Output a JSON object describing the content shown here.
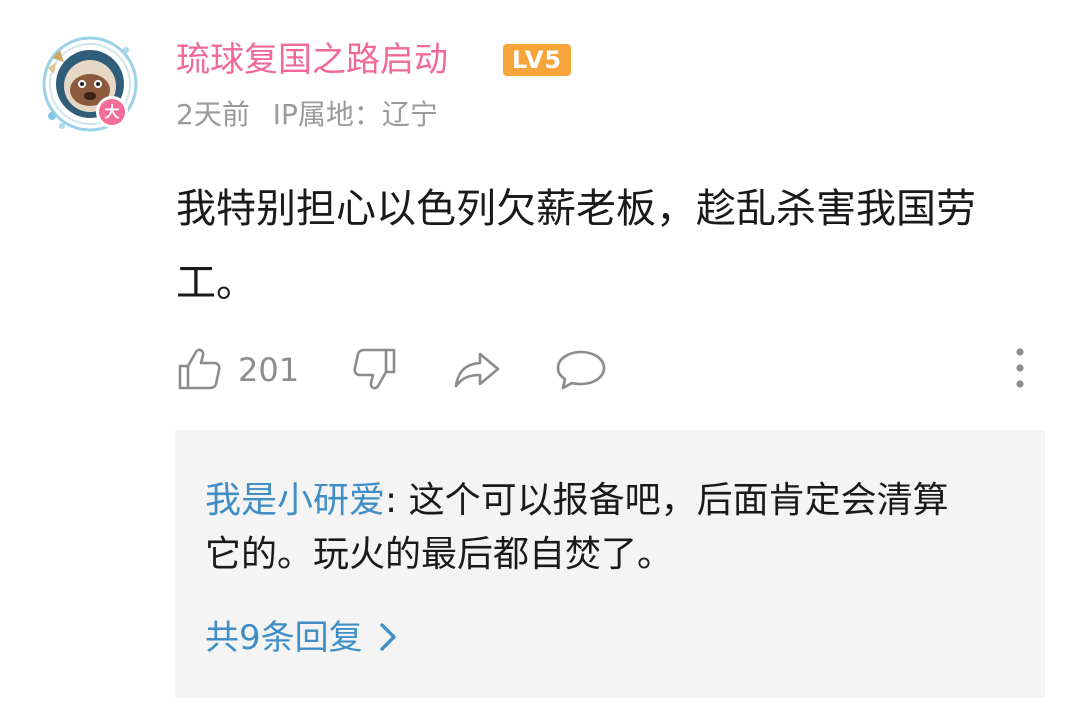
{
  "post": {
    "user": {
      "name": "琉球复国之路启动",
      "level": "LV5",
      "vip_badge": "大",
      "avatar_icon": "avatar-icon"
    },
    "time": "2天前",
    "ip_label": "IP属地：辽宁",
    "text": "我特别担心以色列欠薪老板，趁乱杀害我国劳工。",
    "actions": {
      "like_count": "201",
      "like_icon": "thumbs-up-icon",
      "dislike_icon": "thumbs-down-icon",
      "share_icon": "share-icon",
      "comment_icon": "comment-icon",
      "more_icon": "more-vertical-icon"
    }
  },
  "reply": {
    "user": "我是小研爱",
    "colon": ": ",
    "text": "这个可以报备吧，后面肯定会清算它的。玩火的最后都自焚了。",
    "more_label": "共9条回复"
  },
  "colors": {
    "username": "#f0699a",
    "level_badge": "#f6a53a",
    "link": "#3f8fc6",
    "meta": "#9a9a9a",
    "reply_bg": "#f4f4f4"
  }
}
